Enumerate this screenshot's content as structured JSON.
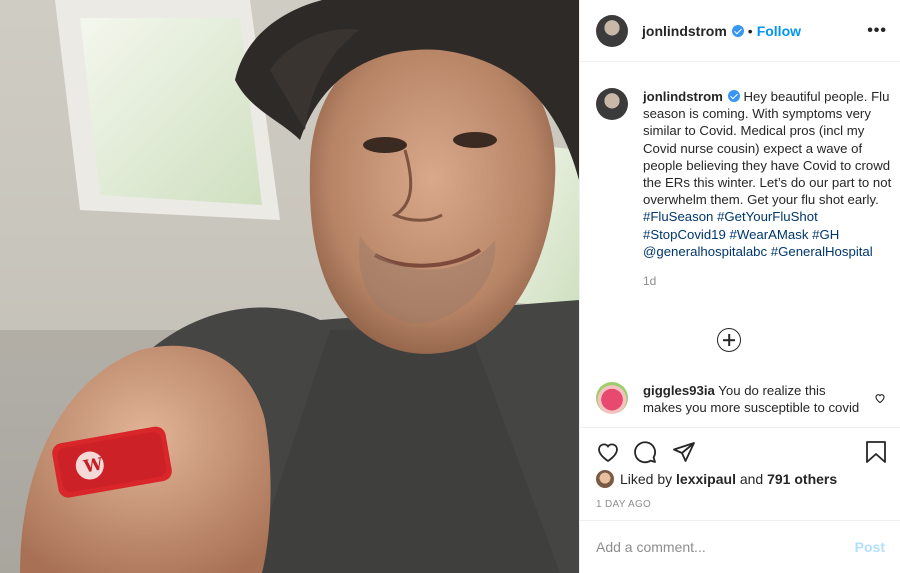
{
  "header": {
    "username": "jonlindstrom",
    "verified": true,
    "separator": "•",
    "follow_label": "Follow",
    "more_icon": "more-options-icon",
    "more_label": "•••"
  },
  "caption": {
    "username": "jonlindstrom",
    "text": "Hey beautiful people. Flu season is coming. With symptoms very similar to Covid. Medical pros (incl my Covid nurse cousin) expect a wave of people believing they have Covid to crowd the ERs this winter. Let’s do our part to not overwhelm them. Get your flu shot early.",
    "tags": [
      "#FluSeason",
      "#GetYourFluShot",
      "#StopCovid19",
      "#WearAMask",
      "#GH",
      "@generalhospitalabc",
      "#GeneralHospital"
    ],
    "time": "1d"
  },
  "load_more_icon": "add-circle-icon",
  "comment": {
    "username": "giggles93ia",
    "text": "You do realize this makes you more susceptible to covid"
  },
  "actions": {
    "like_icon": "heart-icon",
    "comment_icon": "comment-icon",
    "share_icon": "share-icon",
    "save_icon": "bookmark-icon"
  },
  "likes": {
    "prefix": "Liked by",
    "user": "lexxipaul",
    "and": "and",
    "others": "791 others"
  },
  "posted": "1 DAY AGO",
  "add_comment": {
    "placeholder": "Add a comment...",
    "post_label": "Post"
  },
  "colors": {
    "link": "#0095f6",
    "hashtag": "#00376b",
    "bandage": "#d8262b",
    "muted": "#8e8e8e"
  }
}
